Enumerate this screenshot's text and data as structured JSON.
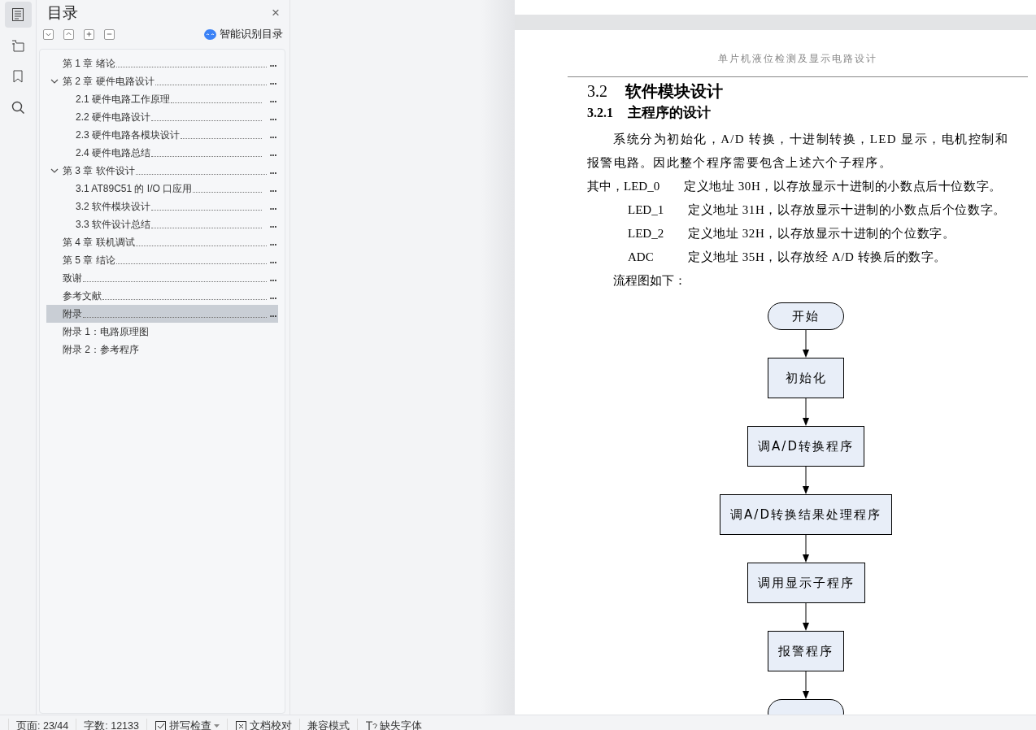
{
  "sidebar": {
    "items": [
      {
        "kind": "toc",
        "selected": true
      },
      {
        "kind": "outline",
        "selected": false
      },
      {
        "kind": "bookmark",
        "selected": false
      },
      {
        "kind": "search",
        "selected": false
      }
    ]
  },
  "toc_panel": {
    "title": "目录",
    "close": "×",
    "smart_button": "智能识别目录",
    "entries": [
      {
        "label": "第 1 章  绪论",
        "page": "...",
        "selected": false
      },
      {
        "label": "第 2 章  硬件电路设计",
        "page": "...",
        "selected": false,
        "expanded": true,
        "children": [
          {
            "label": "2.1  硬件电路工作原理",
            "page": "...",
            "selected": false
          },
          {
            "label": "2.2  硬件电路设计",
            "page": "...",
            "selected": false
          },
          {
            "label": "2.3  硬件电路各模块设计",
            "page": "...",
            "selected": false
          },
          {
            "label": "2.4  硬件电路总结",
            "page": "...",
            "selected": false
          }
        ]
      },
      {
        "label": "第 3 章  软件设计",
        "page": "...",
        "selected": false,
        "expanded": true,
        "children": [
          {
            "label": "3.1  AT89C51 的 I/O 口应用",
            "page": "...",
            "selected": false
          },
          {
            "label": "3.2  软件模块设计",
            "page": "...",
            "selected": false
          },
          {
            "label": "3.3  软件设计总结",
            "page": "...",
            "selected": false
          }
        ]
      },
      {
        "label": "第 4 章  联机调试",
        "page": "...",
        "selected": false
      },
      {
        "label": "第 5 章  结论",
        "page": "...",
        "selected": false
      },
      {
        "label": "致谢",
        "page": "...",
        "selected": false
      },
      {
        "label": "参考文献",
        "page": "...",
        "selected": false
      },
      {
        "label": "附录",
        "page": "...",
        "selected": true
      },
      {
        "label": "附录 1：电路原理图",
        "selected": false
      },
      {
        "label": "附录 2：参考程序",
        "selected": false
      }
    ]
  },
  "document": {
    "header": "单片机液位检测及显示电路设计",
    "heading": {
      "number": "3.2",
      "title": "软件模块设计"
    },
    "subheading": {
      "number": "3.2.1",
      "title": "主程序的设计"
    },
    "paragraph": "系统分为初始化，A/D 转换，十进制转换，LED 显示，电机控制和报警电路。因此整个程序需要包含上述六个子程序。",
    "definitions": [
      {
        "kind": "lead",
        "name": "其中，LED_0",
        "text": "定义地址 30H，以存放显示十进制的小数点后十位数字。"
      },
      {
        "kind": "item",
        "name": "LED_1",
        "text": "定义地址 31H，以存放显示十进制的小数点后个位数字。"
      },
      {
        "kind": "item",
        "name": "LED_2",
        "text": "定义地址 32H，以存放显示十进制的个位数字。"
      },
      {
        "kind": "item",
        "name": "ADC",
        "text": "定义地址 35H，以存放经 A/D 转换后的数字。"
      }
    ],
    "flow_intro": "流程图如下：",
    "flowchart": [
      {
        "kind": "terminal",
        "label": "开始"
      },
      {
        "kind": "process",
        "label": "初始化"
      },
      {
        "kind": "process",
        "label": "调A/D转换程序"
      },
      {
        "kind": "process",
        "label": "调A/D转换结果处理程序"
      },
      {
        "kind": "process",
        "label": "调用显示子程序"
      },
      {
        "kind": "process",
        "label": "报警程序"
      },
      {
        "kind": "terminal"
      }
    ]
  },
  "status_bar": [
    {
      "kind": "text",
      "label": "页面: 23/44"
    },
    {
      "kind": "text",
      "label": "字数: 12133"
    },
    {
      "kind": "check",
      "label": "拼写检查"
    },
    {
      "kind": "proof",
      "label": "文档校对"
    },
    {
      "kind": "text",
      "label": "兼容模式"
    },
    {
      "kind": "font",
      "label": "缺失字体"
    }
  ]
}
